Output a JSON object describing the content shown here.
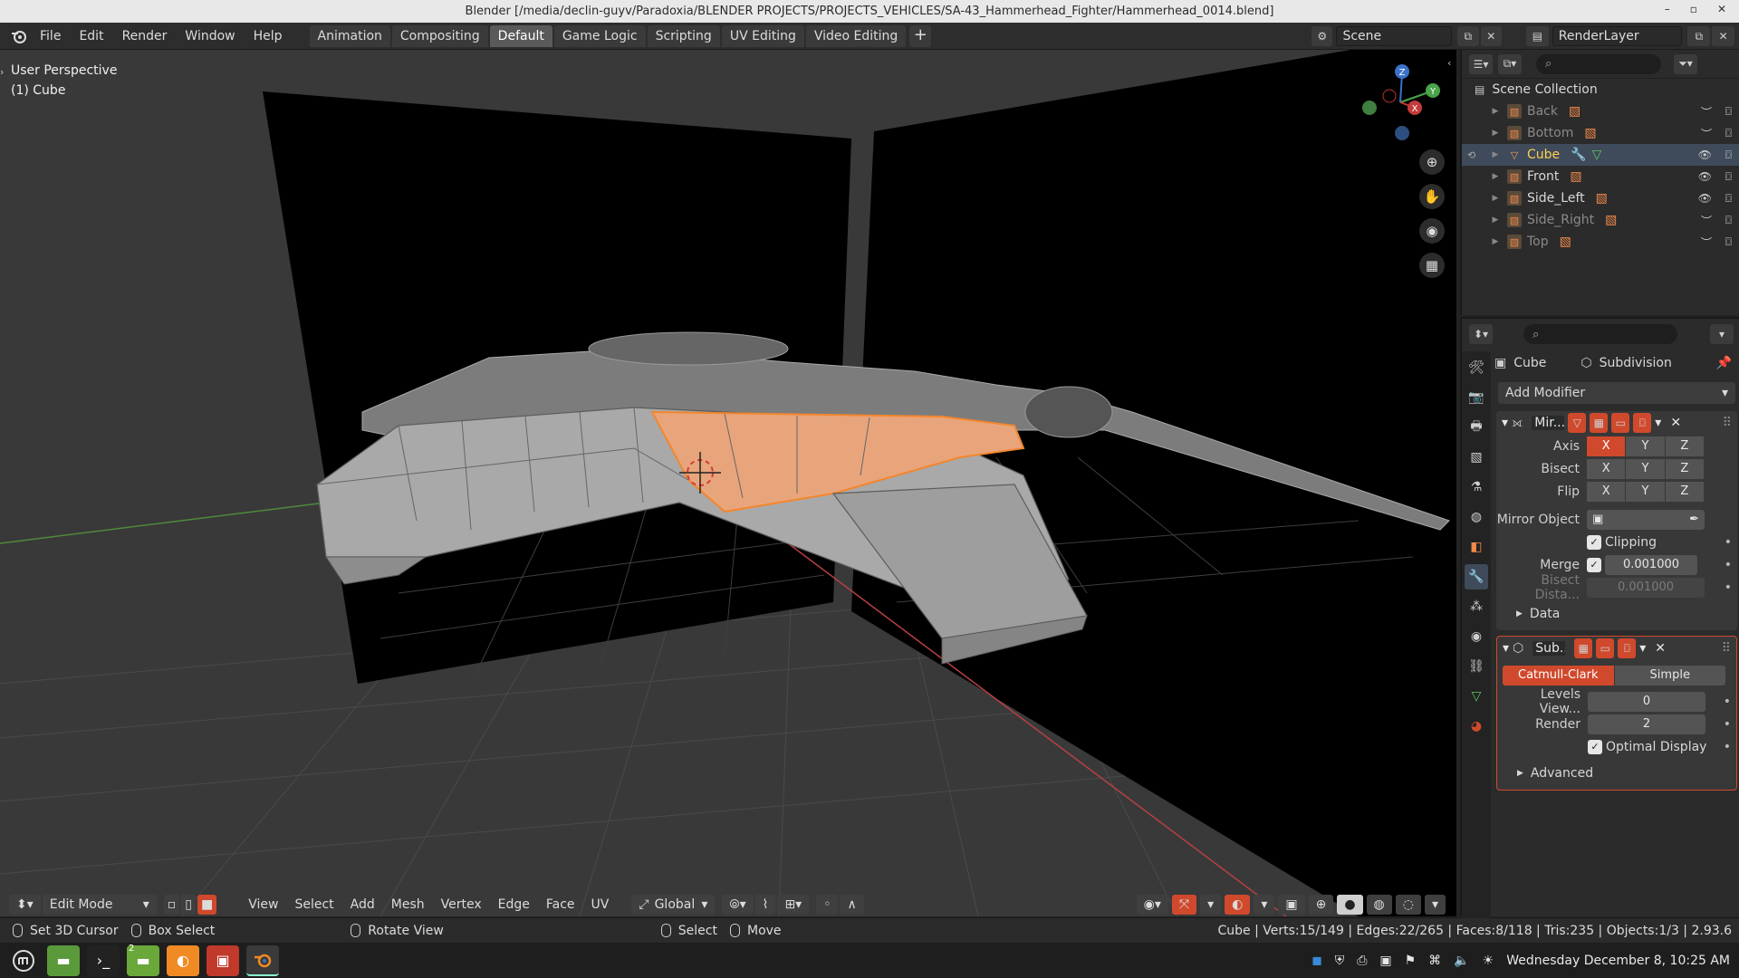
{
  "window": {
    "title": "Blender [/media/declin-guyv/Paradoxia/BLENDER PROJECTS/PROJECTS_VEHICLES/SA-43_Hammerhead_Fighter/Hammerhead_0014.blend]"
  },
  "menubar": {
    "menus": [
      "File",
      "Edit",
      "Render",
      "Window",
      "Help"
    ],
    "workspaces": [
      "Animation",
      "Compositing",
      "Default",
      "Game Logic",
      "Scripting",
      "UV Editing",
      "Video Editing"
    ],
    "active_workspace": "Default",
    "add_symbol": "+",
    "scene": "Scene",
    "render_layer": "RenderLayer"
  },
  "viewport": {
    "perspective": "User Perspective",
    "object": "(1) Cube",
    "gizmo": {
      "z": "Z",
      "y": "Y",
      "x": "X"
    },
    "header": {
      "mode": "Edit Mode",
      "menus": [
        "View",
        "Select",
        "Add",
        "Mesh",
        "Vertex",
        "Edge",
        "Face",
        "UV"
      ],
      "orientation": "Global"
    }
  },
  "statusbar": {
    "left": [
      "Set 3D Cursor",
      "Box Select",
      "Rotate View",
      "Select",
      "Move"
    ],
    "right": "Cube | Verts:15/149 | Edges:22/265 | Faces:8/118 | Tris:235 | Objects:1/3 | 2.93.6"
  },
  "taskbar": {
    "datetime": "Wednesday December  8, 10:25 AM",
    "workspace_badge": "2"
  },
  "outliner": {
    "root": "Scene Collection",
    "items": [
      {
        "name": "Back",
        "visible": false,
        "selected": false
      },
      {
        "name": "Bottom",
        "visible": false,
        "selected": false
      },
      {
        "name": "Cube",
        "visible": true,
        "selected": true
      },
      {
        "name": "Front",
        "visible": true,
        "selected": false
      },
      {
        "name": "Side_Left",
        "visible": true,
        "selected": false
      },
      {
        "name": "Side_Right",
        "visible": false,
        "selected": false
      },
      {
        "name": "Top",
        "visible": false,
        "selected": false
      }
    ]
  },
  "properties": {
    "object_name": "Cube",
    "modifier_context": "Subdivision",
    "add_modifier": "Add Modifier",
    "mirror": {
      "name": "Mir...",
      "axis_label": "Axis",
      "bisect_label": "Bisect",
      "flip_label": "Flip",
      "axes": [
        "X",
        "Y",
        "Z"
      ],
      "mirror_object_label": "Mirror Object",
      "clipping_label": "Clipping",
      "merge_label": "Merge",
      "merge_value": "0.001000",
      "bisect_distance_label": "Bisect Dista...",
      "bisect_distance_value": "0.001000",
      "data_label": "Data"
    },
    "subdivision": {
      "name": "Sub...",
      "type_a": "Catmull-Clark",
      "type_b": "Simple",
      "levels_view_label": "Levels View...",
      "levels_view_value": "0",
      "render_label": "Render",
      "render_value": "2",
      "optimal_label": "Optimal Display",
      "advanced_label": "Advanced"
    }
  },
  "colors": {
    "accent": "#d0492c",
    "selection": "#f0a060",
    "active_blue": "#6aa6e8",
    "object_orange": "#f08a4b"
  }
}
